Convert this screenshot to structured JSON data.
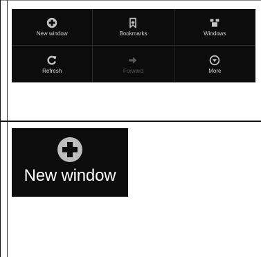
{
  "menu": {
    "items": [
      {
        "label": "New window",
        "icon": "plus-circle-icon"
      },
      {
        "label": "Bookmarks",
        "icon": "bookmark-icon"
      },
      {
        "label": "Windows",
        "icon": "windows-icon"
      },
      {
        "label": "Refresh",
        "icon": "refresh-icon"
      },
      {
        "label": "Forward",
        "icon": "forward-arrow-icon",
        "disabled": true
      },
      {
        "label": "More",
        "icon": "chevron-down-circle-icon"
      }
    ]
  },
  "zoom": {
    "label": "New window",
    "icon": "plus-circle-icon"
  },
  "colors": {
    "panel_bg": "#0c0c0c",
    "label": "#d7d7d7",
    "disabled": "#5a5a5a",
    "icon": "#bfbfbf"
  }
}
